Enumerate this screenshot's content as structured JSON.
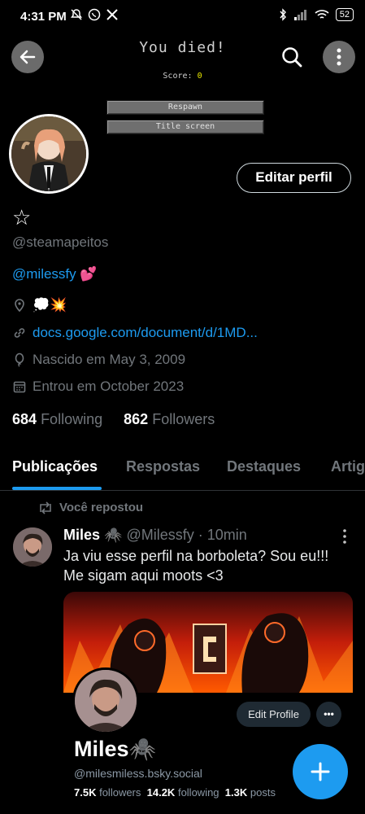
{
  "status_bar": {
    "time": "4:31 PM",
    "battery": "52"
  },
  "game_overlay": {
    "title": "You died!",
    "score_label": "Score: ",
    "score_value": "0",
    "respawn_label": "Respawn",
    "title_screen_label": "Title screen"
  },
  "profile": {
    "edit_label": "Editar perfil",
    "display_name": "☆",
    "handle": "@steamapeitos",
    "bio_mention": "@milessfy",
    "bio_emoji": "💕",
    "location_emojis": "💭💥",
    "website": "docs.google.com/document/d/1MD...",
    "birth": "Nascido em May 3, 2009",
    "joined": "Entrou em October 2023",
    "following_count": "684",
    "following_label": "Following",
    "followers_count": "862",
    "followers_label": "Followers"
  },
  "tabs": [
    "Publicações",
    "Respostas",
    "Destaques",
    "Artigos"
  ],
  "post": {
    "repost_label": "Você repostou",
    "author_name": "Miles",
    "author_emoji": "🕷️",
    "author_handle": "@Milessfy",
    "time": "· 10min",
    "text_line1": "Ja viu esse perfil na borboleta? Sou eu!!!",
    "text_line2": "Me sigam aqui moots <3"
  },
  "embed": {
    "edit_profile_label": "Edit Profile",
    "more_label": "•••",
    "name": "Miles🕷️",
    "handle": "@milesmiless.bsky.social",
    "followers_count": "7.5K",
    "followers_label": "followers",
    "following_count": "14.2K",
    "following_label": "following",
    "posts_count": "1.3K",
    "posts_label": "posts"
  },
  "colors": {
    "accent": "#1d9bf0",
    "background": "#000000",
    "muted": "#71767b"
  }
}
